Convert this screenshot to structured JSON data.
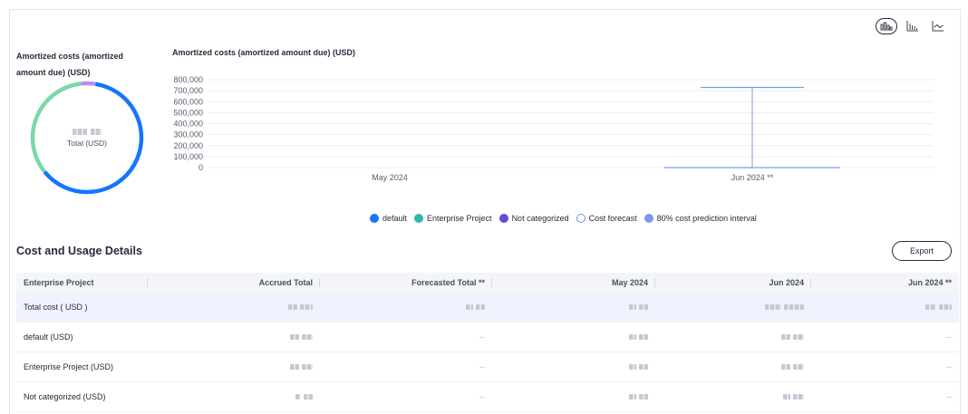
{
  "toolbar": {
    "views": [
      {
        "name": "grouped-bar-view",
        "active": true
      },
      {
        "name": "stacked-bar-view",
        "active": false
      },
      {
        "name": "line-view",
        "active": false
      }
    ]
  },
  "donut": {
    "title": "Amortized costs (amortized amount due) (USD)",
    "center_value": "",
    "center_label": "Total (USD)",
    "segments": [
      {
        "name": "default",
        "share": 0.62,
        "color": "#1476ff"
      },
      {
        "name": "Enterprise Project",
        "share": 0.34,
        "color": "#7dd8a9"
      },
      {
        "name": "Not categorized",
        "share": 0.04,
        "color": "#b88cf1"
      }
    ]
  },
  "chart_data": {
    "type": "line",
    "title": "Amortized costs (amortized amount due) (USD)",
    "categories": [
      "May 2024",
      "Jun 2024 **"
    ],
    "y_ticks": [
      "800,000",
      "700,000",
      "600,000",
      "500,000",
      "400,000",
      "300,000",
      "200,000",
      "100,000",
      "0"
    ],
    "ylim": [
      0,
      800000
    ],
    "series": [
      {
        "name": "default",
        "color": "#1476ff"
      },
      {
        "name": "Enterprise Project",
        "color": "#2ab8a8"
      },
      {
        "name": "Not categorized",
        "color": "#5e4fd6"
      },
      {
        "name": "Cost forecast",
        "color": "#6b8fd8",
        "values": [
          null,
          0
        ]
      },
      {
        "name": "80% cost prediction interval",
        "color": "#7a9bea",
        "low": 0,
        "high": 730000
      }
    ],
    "legend_position": "bottom-center",
    "grid": true
  },
  "legend": [
    {
      "label": "default",
      "color": "#1476ff",
      "filled": true
    },
    {
      "label": "Enterprise Project",
      "color": "#2ab8a8",
      "filled": true
    },
    {
      "label": "Not categorized",
      "color": "#5e4fd6",
      "filled": true
    },
    {
      "label": "Cost forecast",
      "color": "#6b8fd8",
      "filled": false
    },
    {
      "label": "80% cost prediction interval",
      "color": "#7a9bea",
      "filled": true
    }
  ],
  "details": {
    "title": "Cost and Usage Details",
    "export_label": "Export",
    "columns": [
      "Enterprise Project",
      "Accrued Total",
      "Forecasted Total **",
      "May 2024",
      "Jun 2024",
      "Jun 2024 **"
    ],
    "rows": [
      {
        "label": "Total cost ( USD )",
        "cells": [
          "blur",
          "blur",
          "blur",
          "blur",
          "blur"
        ]
      },
      {
        "label": "default (USD)",
        "cells": [
          "blur",
          "--",
          "blur",
          "blur",
          "--"
        ]
      },
      {
        "label": "Enterprise Project (USD)",
        "cells": [
          "blur",
          "--",
          "blur",
          "blur",
          "--"
        ]
      },
      {
        "label": "Not categorized (USD)",
        "cells": [
          "blur",
          "--",
          "blur",
          "blur",
          "--"
        ]
      }
    ]
  }
}
